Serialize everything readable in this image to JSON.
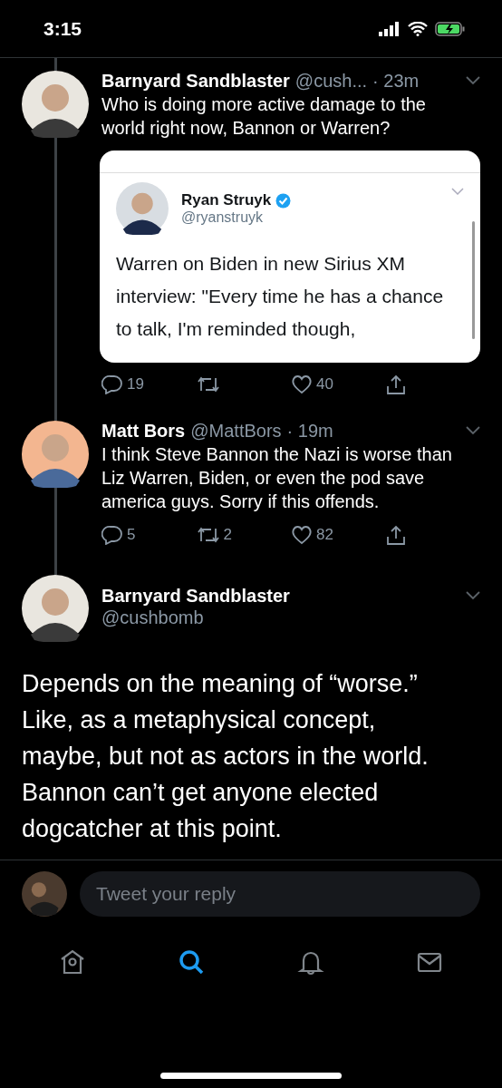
{
  "status_bar": {
    "time": "3:15"
  },
  "tweets": [
    {
      "kind": "reply",
      "name": "Barnyard Sandblaster",
      "handle": "@cush...",
      "time": "· 23m",
      "text": "Who is doing more active damage to the world right now, Bannon or Warren?",
      "quote_image": {
        "name": "Ryan Struyk",
        "handle": "@ryanstruyk",
        "text": "Warren on Biden in new Sirius XM interview: \"Every time he has a chance to talk, I'm reminded though,"
      },
      "actions": {
        "replies": "19",
        "likes": "40"
      }
    },
    {
      "kind": "reply",
      "name": "Matt Bors",
      "handle": "@MattBors",
      "time": "· 19m",
      "text": "I think Steve Bannon the Nazi is worse than Liz Warren, Biden, or even the pod save america guys. Sorry if this offends.",
      "actions": {
        "replies": "5",
        "retweets": "2",
        "likes": "82"
      }
    },
    {
      "kind": "focus",
      "name": "Barnyard Sandblaster",
      "handle": "@cushbomb",
      "text": "Depends on the meaning of “worse.” Like, as a metaphysical concept, maybe, but not as actors in the world. Bannon can’t get anyone elected dogcatcher at this point."
    }
  ],
  "reply_bar": {
    "placeholder": "Tweet your reply"
  },
  "tab_bar": [
    {
      "selected": false
    },
    {
      "selected": true
    },
    {
      "selected": false
    },
    {
      "selected": false
    }
  ]
}
